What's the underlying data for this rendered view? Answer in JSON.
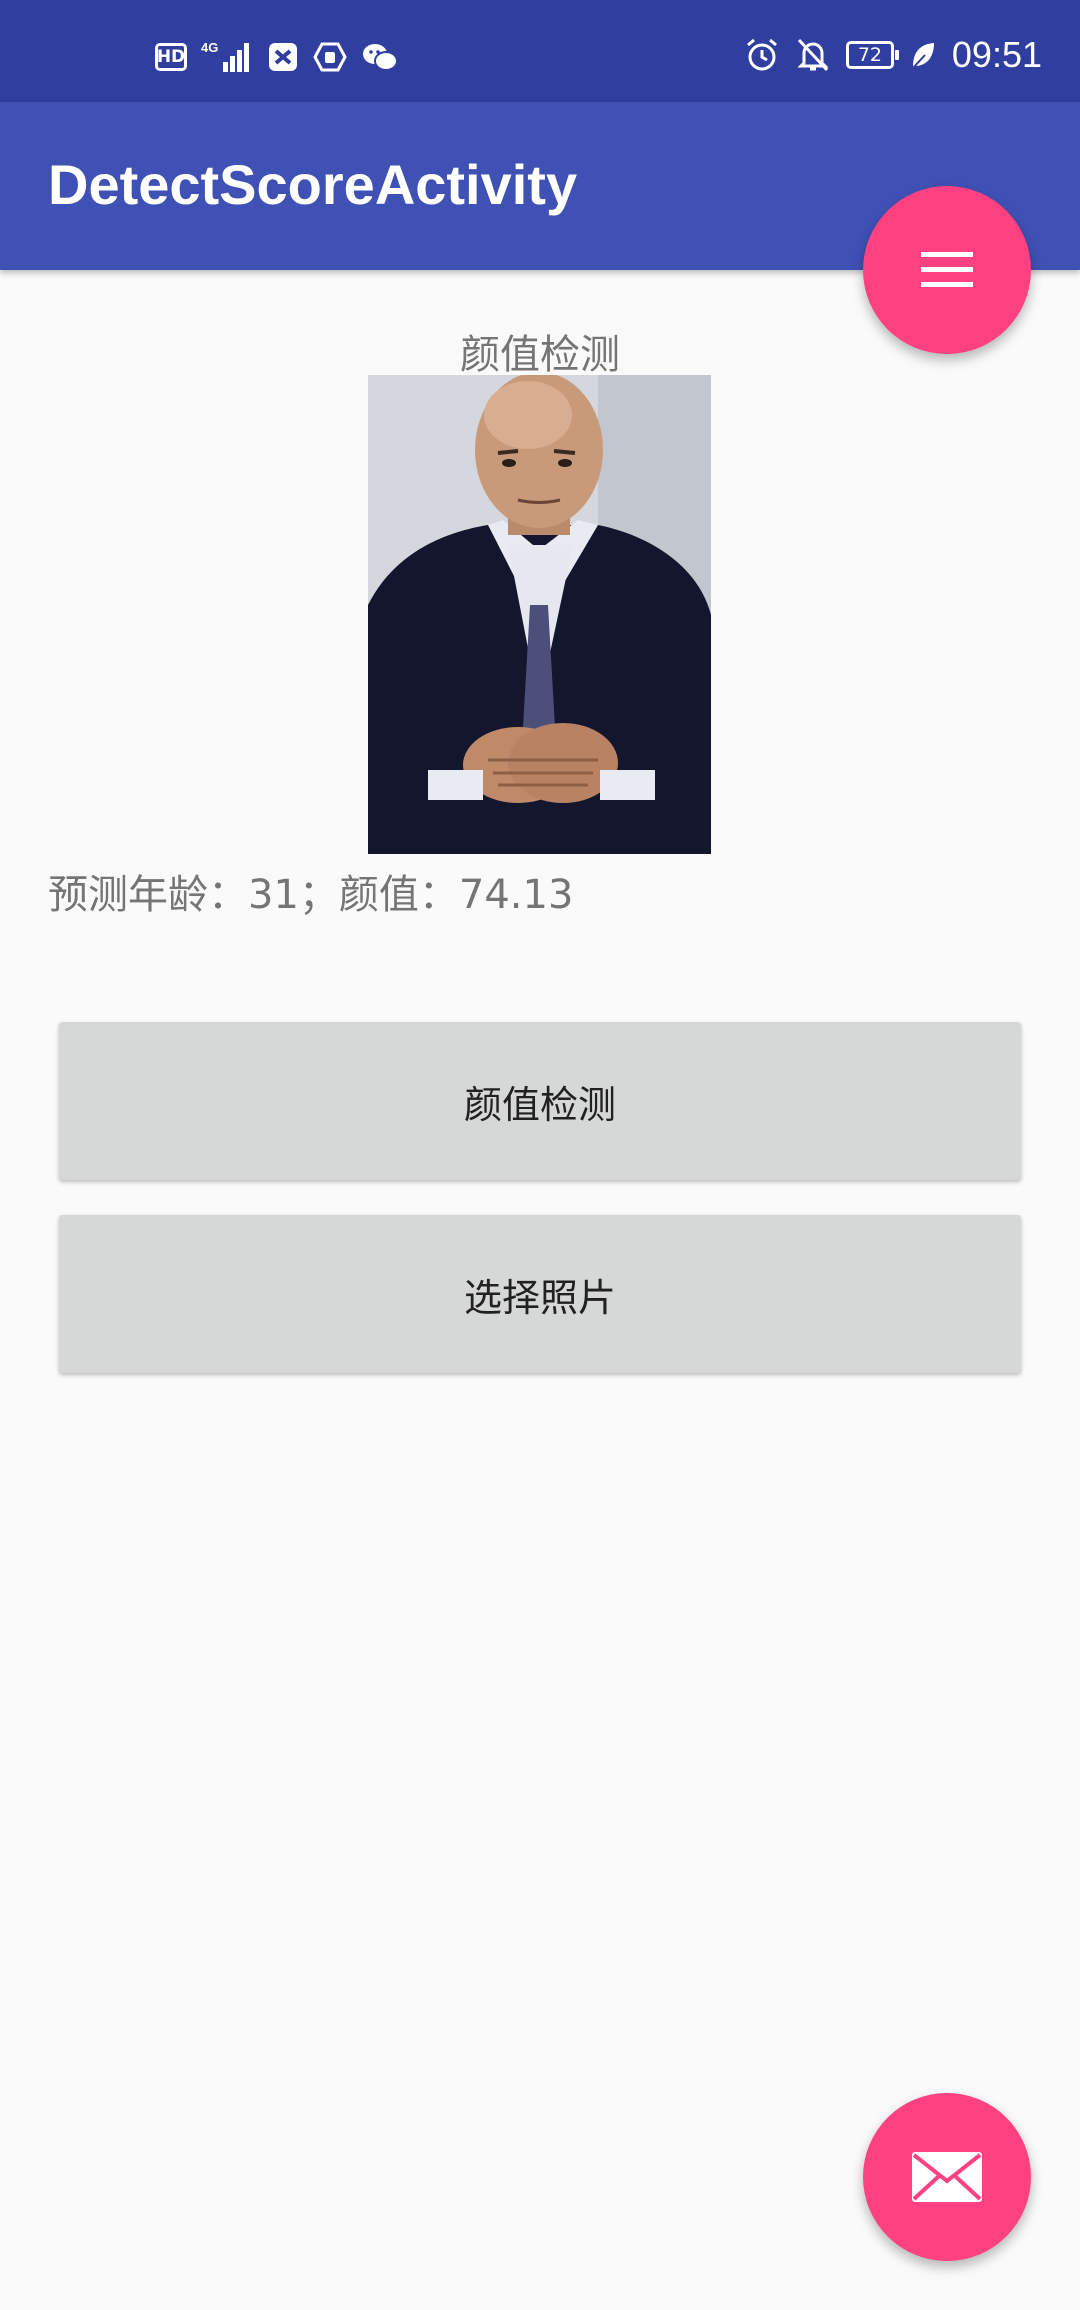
{
  "status_bar": {
    "network_badge": "HD",
    "signal_label": "4G",
    "battery_level": "72",
    "time": "09:51",
    "icons": [
      "hd-icon",
      "signal-icon",
      "app-notification-icon",
      "shield-icon",
      "wechat-icon",
      "alarm-icon",
      "mute-bell-icon",
      "battery-icon",
      "leaf-icon"
    ]
  },
  "app_bar": {
    "title": "DetectScoreActivity"
  },
  "fab_top": {
    "icon": "menu-icon"
  },
  "fab_bottom": {
    "icon": "mail-icon"
  },
  "content": {
    "heading": "颜值检测",
    "photo": "portrait-photo",
    "result": "预测年龄：31；颜值：74.13"
  },
  "buttons": {
    "detect_label": "颜值检测",
    "choose_label": "选择照片"
  },
  "colors": {
    "status_bar": "#303f9f",
    "app_bar": "#3f51b5",
    "accent": "#ff4081",
    "background": "#fafafa",
    "button": "#d6d7d7"
  }
}
